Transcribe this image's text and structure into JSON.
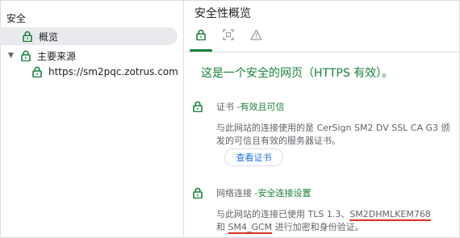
{
  "sidebar": {
    "heading": "安全",
    "overview_label": "概览",
    "main_origin_label": "主要来源",
    "origin_label": "https://sm2pqc.zotrus.com"
  },
  "main": {
    "title": "安全性概览",
    "tabs": [
      "lock-icon",
      "scan-icon",
      "warning-icon"
    ],
    "headline": "这是一个安全的网页（HTTPS 有效）。",
    "certificate": {
      "label": "证书 - ",
      "status": "有效且可信",
      "desc": "与此网站的连接使用的是 CerSign SM2 DV SSL CA G3 颁发的可信且有效的服务器证书。",
      "button": "查看证书"
    },
    "connection": {
      "label": "网络连接 - ",
      "status": "安全连接设置",
      "desc_part1": "与此网站的连接已使用 TLS 1.3、",
      "kex": "SM2DHMLKEM768",
      "desc_and": "和 ",
      "cipher": "SM4_GCM",
      "desc_part2": " 进行加密和身份验证。"
    }
  },
  "colors": {
    "secure_green": "#188038",
    "link_blue": "#1a73e8",
    "highlight_red": "#d93025"
  }
}
